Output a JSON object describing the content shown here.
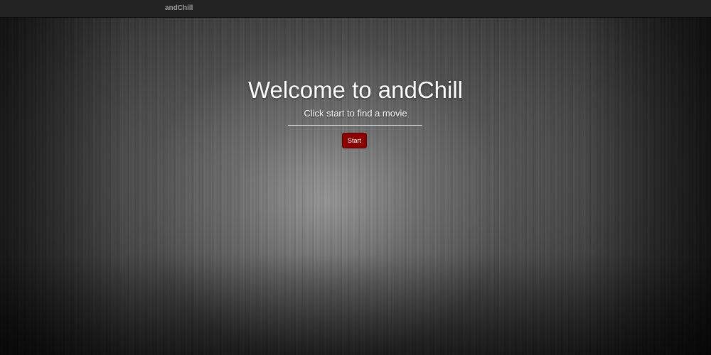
{
  "navbar": {
    "brand": "andChill"
  },
  "hero": {
    "title": "Welcome to andChill",
    "subtitle": "Click start to find a movie",
    "start_label": "Start"
  },
  "colors": {
    "navbar_bg": "#222222",
    "brand_text": "#9d9d9d",
    "start_button_bg": "#8b0000",
    "hero_text": "#ffffff"
  }
}
